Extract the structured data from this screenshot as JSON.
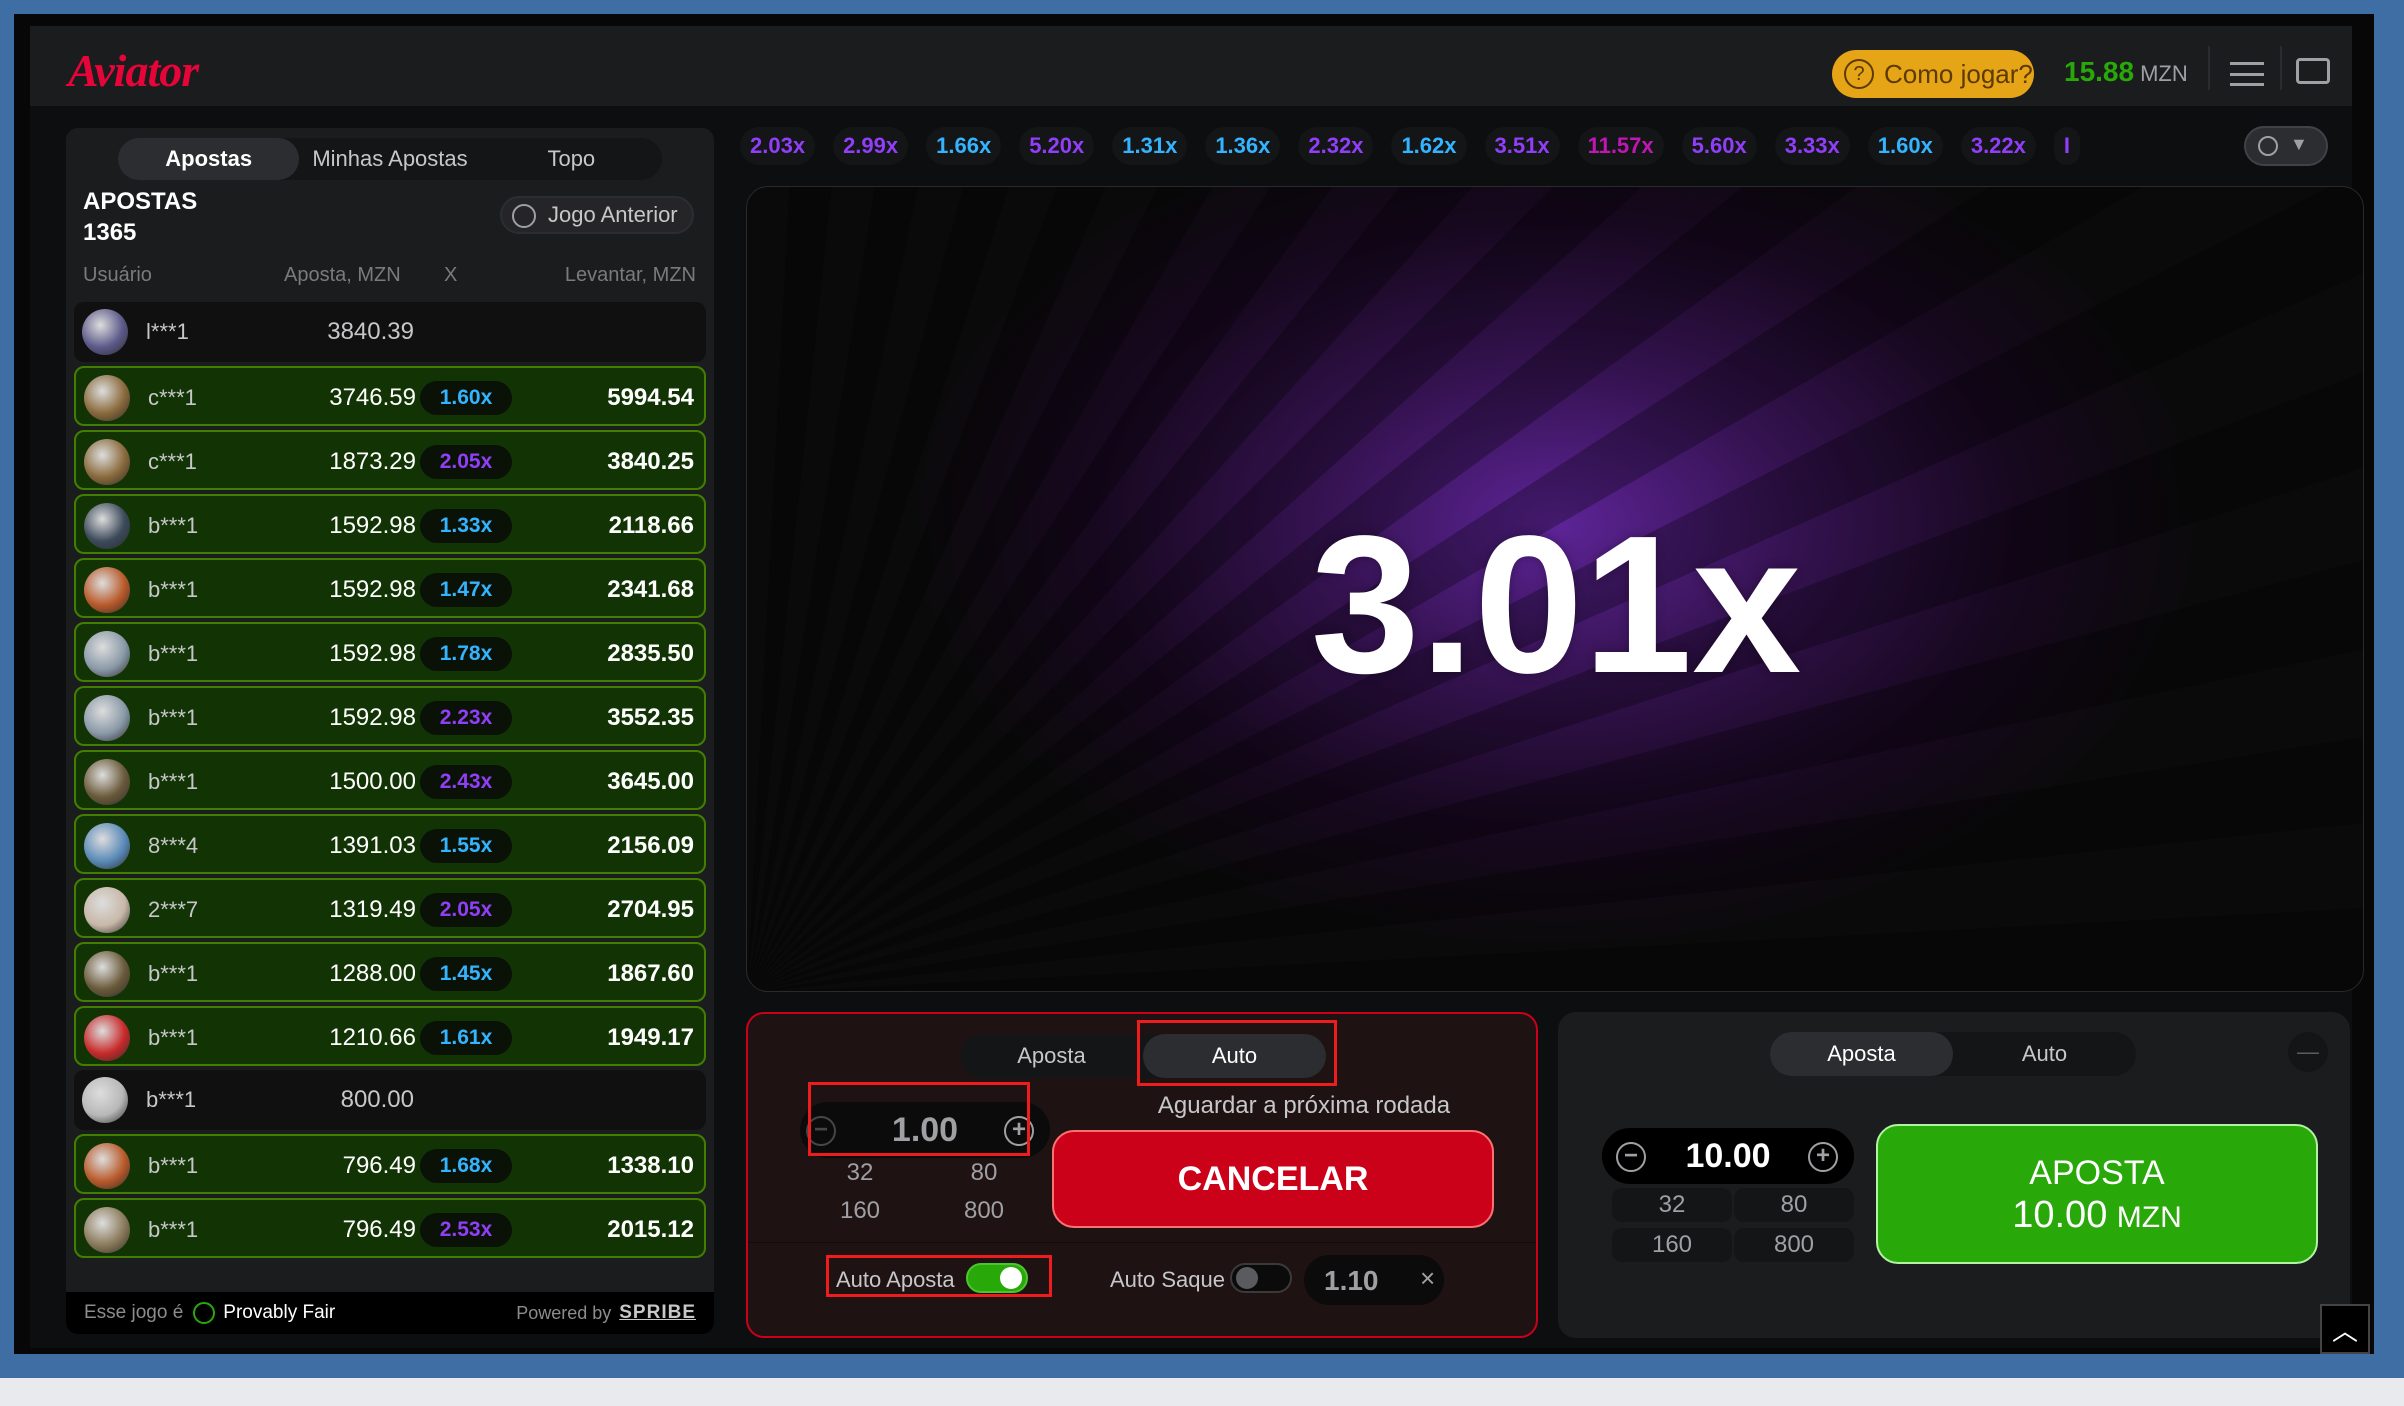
{
  "header": {
    "logo": "Aviator",
    "how_to_play": "Como jogar?",
    "balance": "15.88",
    "currency": "MZN"
  },
  "left_panel": {
    "tabs": [
      "Apostas",
      "Minhas Apostas",
      "Topo"
    ],
    "bets_label": "APOSTAS",
    "bets_count": "1365",
    "previous_game": "Jogo Anterior",
    "columns": [
      "Usuário",
      "Aposta, MZN",
      "X",
      "Levantar, MZN"
    ],
    "rows": [
      {
        "user": "l***1",
        "bet": "3840.39",
        "mult": "",
        "cashout": "",
        "win": false,
        "mult_color": "#34b4ff"
      },
      {
        "user": "c***1",
        "bet": "3746.59",
        "mult": "1.60x",
        "cashout": "5994.54",
        "win": true,
        "mult_color": "#34b4ff"
      },
      {
        "user": "c***1",
        "bet": "1873.29",
        "mult": "2.05x",
        "cashout": "3840.25",
        "win": true,
        "mult_color": "#913ef8"
      },
      {
        "user": "b***1",
        "bet": "1592.98",
        "mult": "1.33x",
        "cashout": "2118.66",
        "win": true,
        "mult_color": "#34b4ff"
      },
      {
        "user": "b***1",
        "bet": "1592.98",
        "mult": "1.47x",
        "cashout": "2341.68",
        "win": true,
        "mult_color": "#34b4ff"
      },
      {
        "user": "b***1",
        "bet": "1592.98",
        "mult": "1.78x",
        "cashout": "2835.50",
        "win": true,
        "mult_color": "#34b4ff"
      },
      {
        "user": "b***1",
        "bet": "1592.98",
        "mult": "2.23x",
        "cashout": "3552.35",
        "win": true,
        "mult_color": "#913ef8"
      },
      {
        "user": "b***1",
        "bet": "1500.00",
        "mult": "2.43x",
        "cashout": "3645.00",
        "win": true,
        "mult_color": "#913ef8"
      },
      {
        "user": "8***4",
        "bet": "1391.03",
        "mult": "1.55x",
        "cashout": "2156.09",
        "win": true,
        "mult_color": "#34b4ff"
      },
      {
        "user": "2***7",
        "bet": "1319.49",
        "mult": "2.05x",
        "cashout": "2704.95",
        "win": true,
        "mult_color": "#913ef8"
      },
      {
        "user": "b***1",
        "bet": "1288.00",
        "mult": "1.45x",
        "cashout": "1867.60",
        "win": true,
        "mult_color": "#34b4ff"
      },
      {
        "user": "b***1",
        "bet": "1210.66",
        "mult": "1.61x",
        "cashout": "1949.17",
        "win": true,
        "mult_color": "#34b4ff"
      },
      {
        "user": "b***1",
        "bet": "800.00",
        "mult": "",
        "cashout": "",
        "win": false,
        "mult_color": "#34b4ff"
      },
      {
        "user": "b***1",
        "bet": "796.49",
        "mult": "1.68x",
        "cashout": "1338.10",
        "win": true,
        "mult_color": "#34b4ff"
      },
      {
        "user": "b***1",
        "bet": "796.49",
        "mult": "2.53x",
        "cashout": "2015.12",
        "win": true,
        "mult_color": "#913ef8"
      }
    ],
    "footer_prefix": "Esse jogo é",
    "provably_fair": "Provably Fair",
    "powered_by": "Powered by",
    "brand": "SPRIBE"
  },
  "history": [
    {
      "v": "2.03x",
      "c": "#913ef8"
    },
    {
      "v": "2.99x",
      "c": "#913ef8"
    },
    {
      "v": "1.66x",
      "c": "#34b4ff"
    },
    {
      "v": "5.20x",
      "c": "#913ef8"
    },
    {
      "v": "1.31x",
      "c": "#34b4ff"
    },
    {
      "v": "1.36x",
      "c": "#34b4ff"
    },
    {
      "v": "2.32x",
      "c": "#913ef8"
    },
    {
      "v": "1.62x",
      "c": "#34b4ff"
    },
    {
      "v": "3.51x",
      "c": "#913ef8"
    },
    {
      "v": "11.57x",
      "c": "#c017b4"
    },
    {
      "v": "5.60x",
      "c": "#913ef8"
    },
    {
      "v": "3.33x",
      "c": "#913ef8"
    },
    {
      "v": "1.60x",
      "c": "#34b4ff"
    },
    {
      "v": "3.22x",
      "c": "#913ef8"
    },
    {
      "v": "I",
      "c": "#913ef8"
    }
  ],
  "game": {
    "multiplier": "3.01x"
  },
  "bet_panel_1": {
    "tabs": [
      "Aposta",
      "Auto"
    ],
    "amount": "1.00",
    "quick": [
      "32",
      "80",
      "160",
      "800"
    ],
    "wait_message": "Aguardar a próxima rodada",
    "cancel": "CANCELAR",
    "auto_bet": "Auto Aposta",
    "auto_cashout": "Auto Saque",
    "auto_cashout_value": "1.10",
    "clear": "×",
    "auto_bet_on": true,
    "auto_cashout_on": false
  },
  "bet_panel_2": {
    "tabs": [
      "Aposta",
      "Auto"
    ],
    "amount": "10.00",
    "quick": [
      "32",
      "80",
      "160",
      "800"
    ],
    "bet_label": "APOSTA",
    "bet_amount": "10.00",
    "bet_currency": "MZN",
    "remove": "—"
  },
  "colors": {
    "accent_red": "#e50539",
    "green": "#28a909",
    "blue_mult": "#34b4ff",
    "purple_mult": "#913ef8"
  }
}
